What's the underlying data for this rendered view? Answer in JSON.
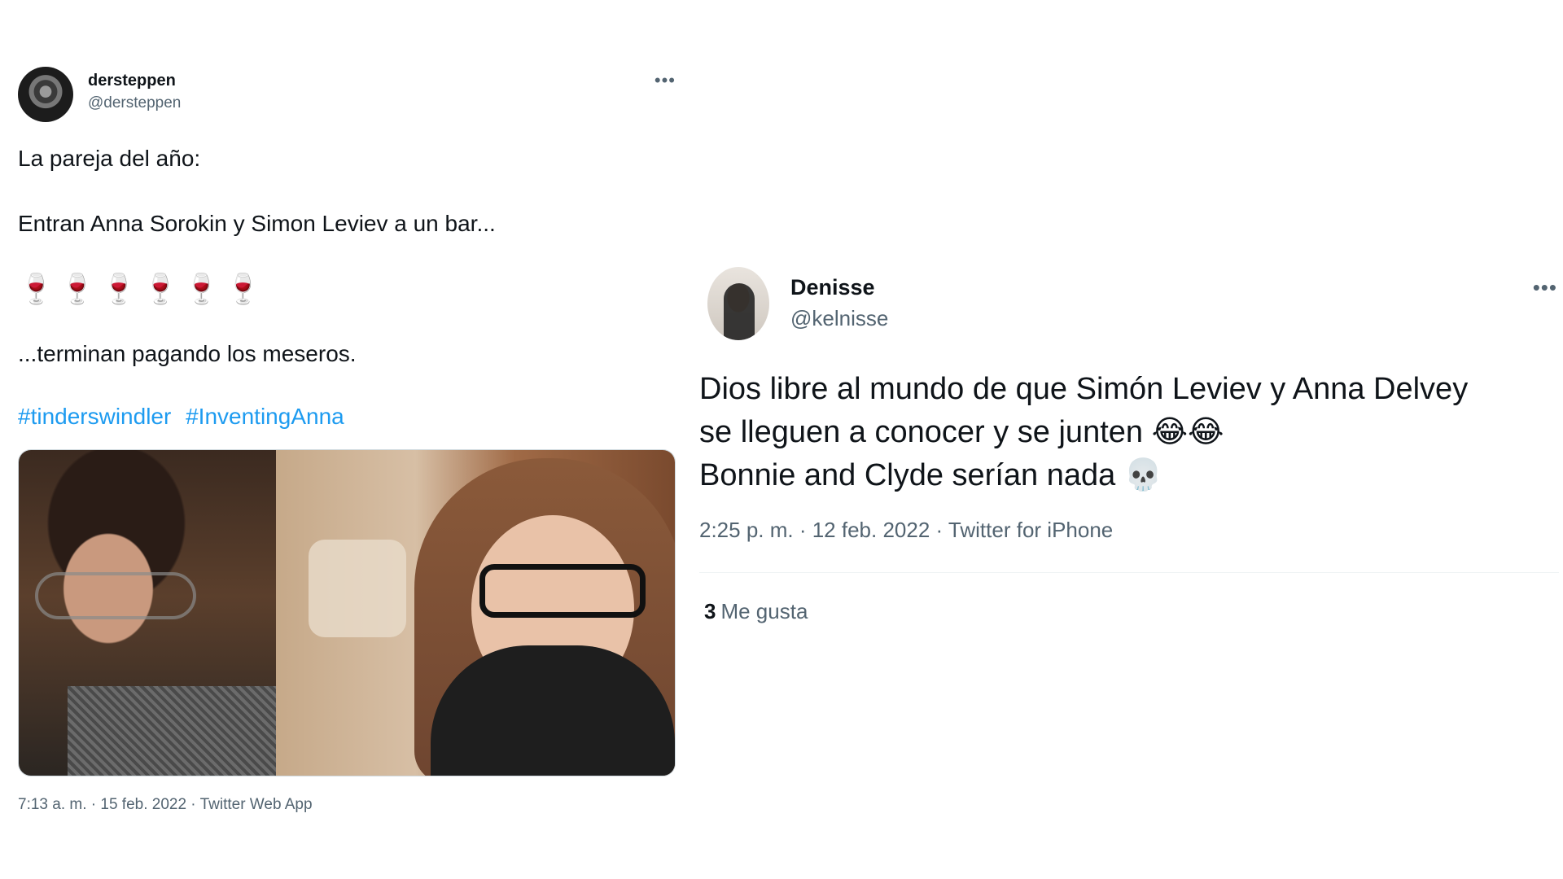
{
  "tweet_left": {
    "display_name": "dersteppen",
    "handle": "@dersteppen",
    "more_label": "•••",
    "line1": "La pareja del año:",
    "line2": "Entran Anna Sorokin y Simon Leviev a un bar...",
    "emoji_line": "🍷🍷🍷🍷🍷🍷",
    "line3": "...terminan pagando los meseros.",
    "hashtags": [
      "#tinderswindler",
      "#InventingAnna"
    ],
    "meta": "7:13 a. m. · 15 feb. 2022 · Twitter Web App"
  },
  "tweet_right": {
    "display_name": "Denisse",
    "handle": "@kelnisse",
    "more_label": "•••",
    "body_line1": "Dios libre al mundo de que Simón Leviev y Anna Delvey",
    "body_line2": "se lleguen a conocer y se junten 😂😂",
    "body_line3": "Bonnie and Clyde serían nada 💀",
    "meta": "2:25 p. m. · 12 feb. 2022 · Twitter for iPhone",
    "likes_count": "3",
    "likes_label": "Me gusta"
  }
}
